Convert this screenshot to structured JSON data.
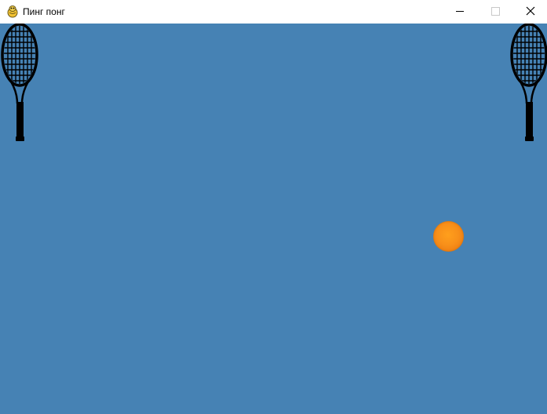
{
  "window": {
    "title": "Пинг понг",
    "icon": "pygame-snake-icon",
    "controls": {
      "minimize_icon": "minimize-icon",
      "maximize_icon": "maximize-icon",
      "close_icon": "close-icon"
    }
  },
  "game": {
    "background_color": "#4682b4",
    "left_racket": {
      "icon": "tennis-racket-icon",
      "color": "#000000"
    },
    "right_racket": {
      "icon": "tennis-racket-icon",
      "color": "#000000"
    },
    "ball": {
      "icon": "tennis-ball",
      "color": "#f7911a"
    }
  }
}
